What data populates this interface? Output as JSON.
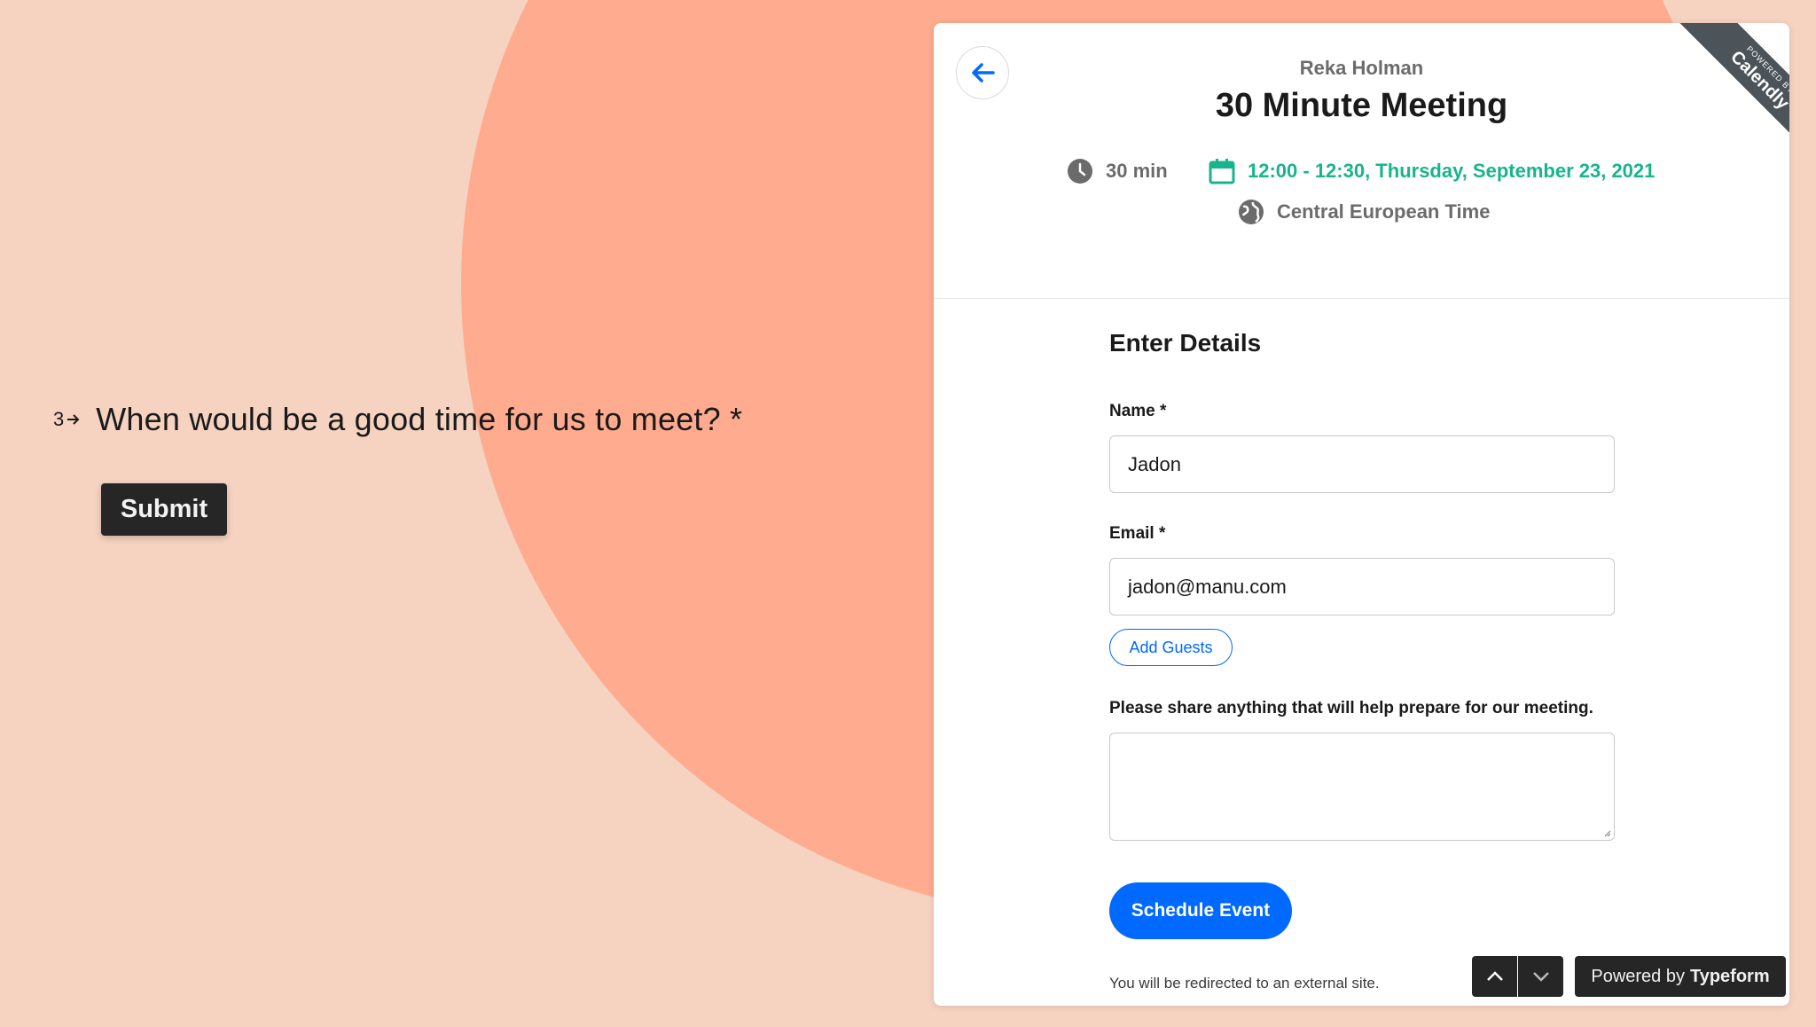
{
  "question": {
    "number": "3",
    "text": "When would be a good time for us to meet? *",
    "submit_label": "Submit"
  },
  "calendly": {
    "ribbon_small": "POWERED BY",
    "ribbon_brand": "Calendly",
    "host_name": "Reka Holman",
    "event_title": "30 Minute Meeting",
    "duration": "30 min",
    "datetime": "12:00 - 12:30, Thursday, September 23, 2021",
    "timezone": "Central European Time",
    "form": {
      "section_title": "Enter Details",
      "name_label": "Name *",
      "name_value": "Jadon",
      "email_label": "Email *",
      "email_value": "jadon@manu.com",
      "add_guests_label": "Add Guests",
      "notes_label": "Please share anything that will help prepare for our meeting.",
      "notes_value": "",
      "schedule_label": "Schedule Event",
      "redirect_note": "You will be redirected to an external site."
    }
  },
  "footer": {
    "powered_prefix": "Powered by",
    "powered_brand": "Typeform"
  },
  "colors": {
    "background": "#f6d2c0",
    "blob": "#ffab8f",
    "accent_blue": "#0069ff",
    "accent_green": "#19b48c",
    "dark_button": "#262626"
  },
  "icons": [
    "arrow-right-icon",
    "arrow-left-icon",
    "clock-icon",
    "calendar-icon",
    "globe-icon",
    "chevron-up-icon",
    "chevron-down-icon"
  ]
}
